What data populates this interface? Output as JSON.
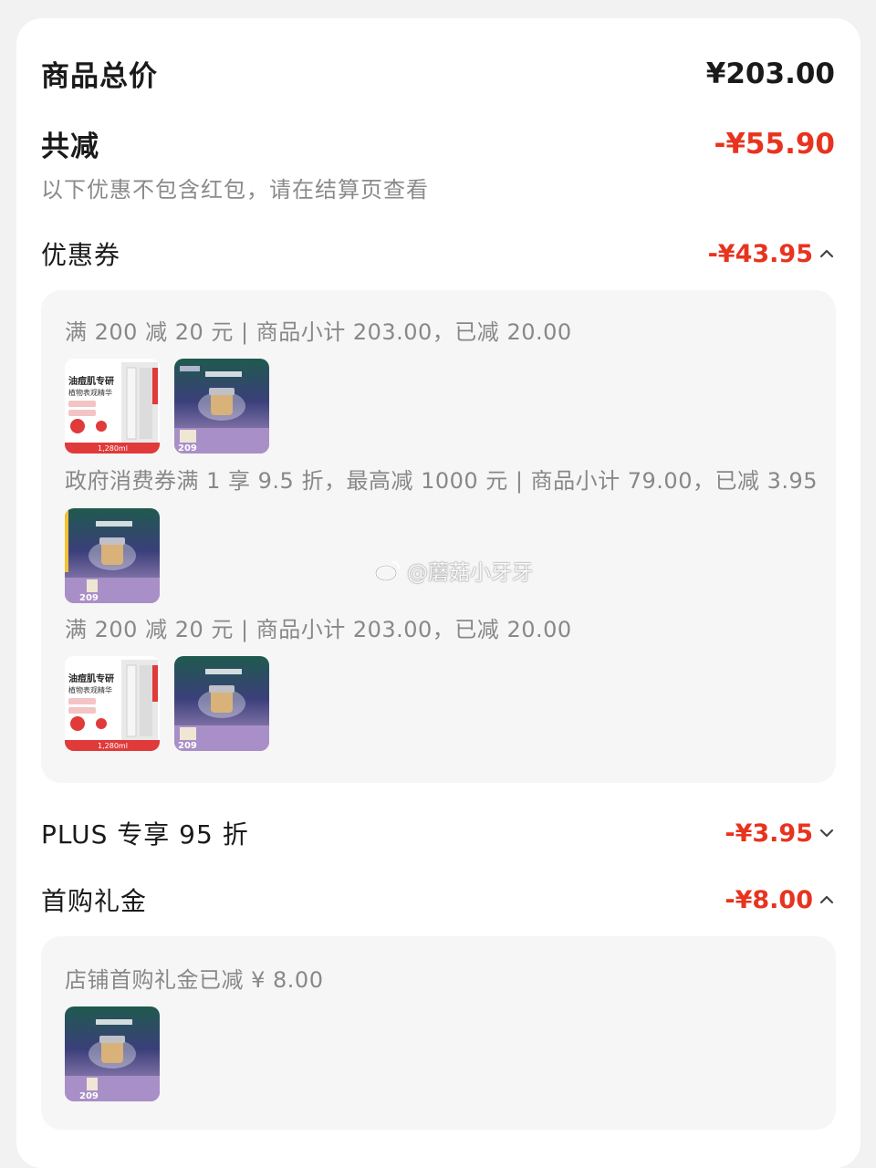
{
  "summary": {
    "total_label": "商品总价",
    "total_value": "¥203.00",
    "reduce_label": "共减",
    "reduce_value": "-¥55.90",
    "note": "以下优惠不包含红包，请在结算页查看"
  },
  "coupons": {
    "label": "优惠券",
    "value": "-¥43.95",
    "expanded": true,
    "items": [
      {
        "text": "满 200 减 20 元 | 商品小计 203.00，已减 20.00",
        "products": [
          "serum-box",
          "cream-box"
        ]
      },
      {
        "text": "政府消费券满 1 享 9.5 折，最高减 1000 元 | 商品小计 79.00，已减 3.95",
        "products": [
          "cream-box"
        ]
      },
      {
        "text": "满 200 减 20 元 | 商品小计 203.00，已减 20.00",
        "products": [
          "serum-box",
          "cream-box"
        ]
      }
    ]
  },
  "plus": {
    "label": "PLUS 专享 95 折",
    "value": "-¥3.95",
    "expanded": false
  },
  "first_purchase": {
    "label": "首购礼金",
    "value": "-¥8.00",
    "expanded": true,
    "detail": "店铺首购礼金已减 ¥ 8.00",
    "products": [
      "cream-box"
    ]
  },
  "watermark": "@蘑菇小牙牙",
  "product_thumbs": {
    "serum_headline": "油痘肌专研",
    "serum_sub": "植物表观精华",
    "serum_price": "1,280ml",
    "cream_price": "209"
  },
  "colors": {
    "accent": "#e8331f",
    "panel": "#f6f6f6",
    "muted": "#8a8a8a"
  }
}
